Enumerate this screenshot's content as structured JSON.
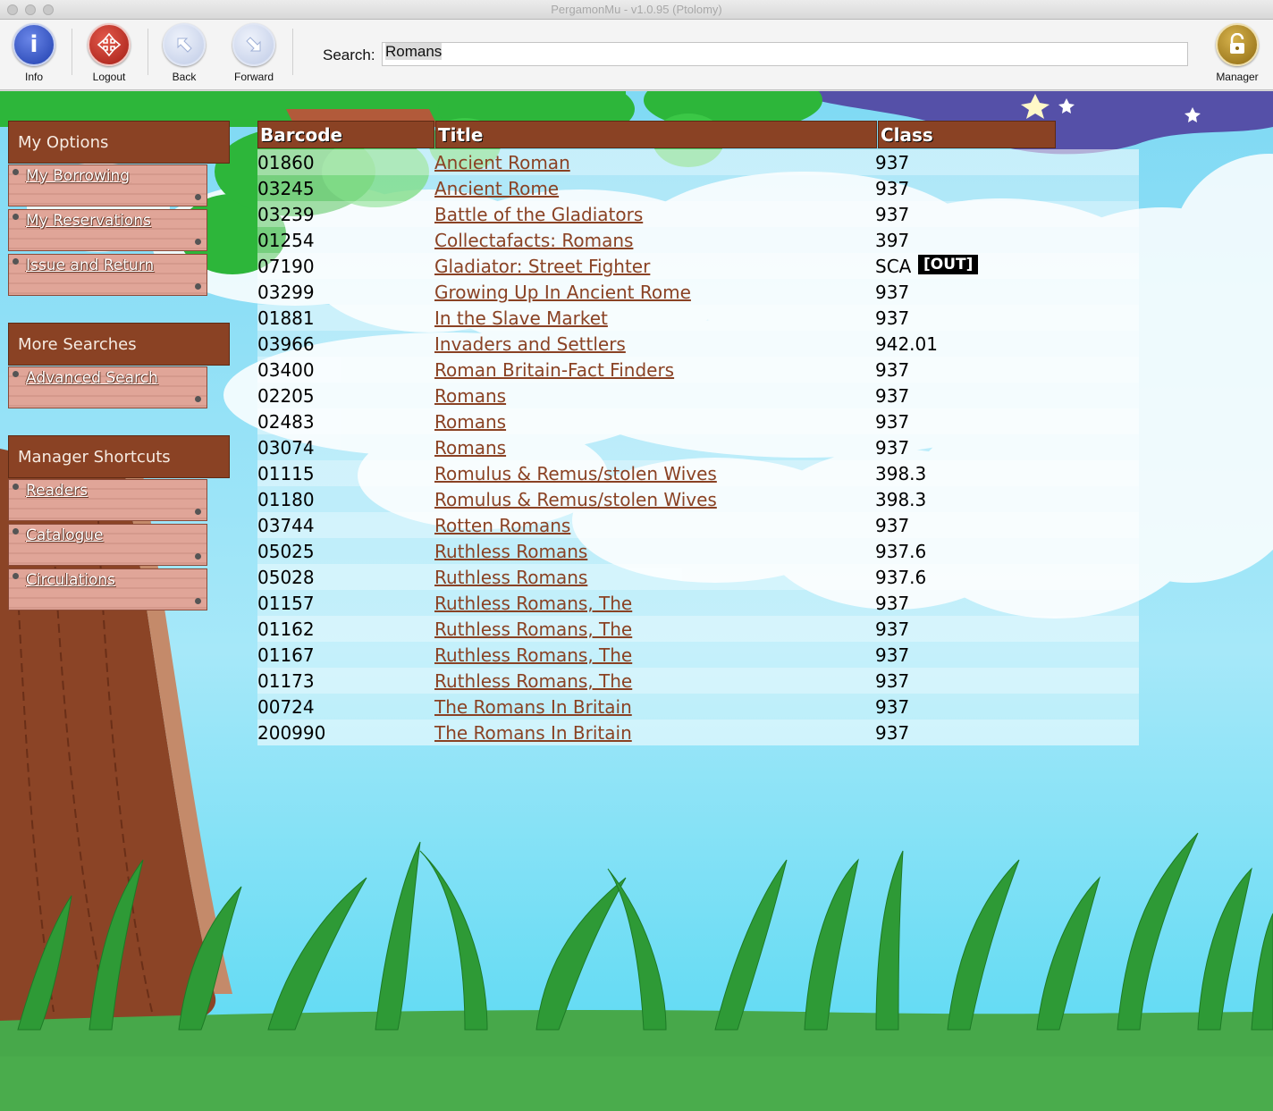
{
  "window": {
    "title": "PergamonMu - v1.0.95 (Ptolomy)"
  },
  "toolbar": {
    "info_label": "Info",
    "logout_label": "Logout",
    "back_label": "Back",
    "forward_label": "Forward",
    "manager_label": "Manager",
    "search_label": "Search:",
    "search_value": "Romans"
  },
  "icons": {
    "info": "info-icon",
    "logout": "logout-icon",
    "back": "back-arrow-icon",
    "forward": "forward-arrow-icon",
    "manager": "lock-icon"
  },
  "colors": {
    "accent": "#8a4224",
    "plank": "#e0a598",
    "title_link": "#8a4224"
  },
  "sidebar": {
    "sections": [
      {
        "title": "My Options",
        "items": [
          "My Borrowing",
          "My Reservations",
          "Issue and Return"
        ]
      },
      {
        "title": "More Searches",
        "items": [
          "Advanced Search"
        ]
      },
      {
        "title": "Manager Shortcuts",
        "items": [
          "Readers",
          "Catalogue",
          "Circulations"
        ]
      }
    ]
  },
  "table": {
    "headers": {
      "barcode": "Barcode",
      "title": "Title",
      "class": "Class"
    },
    "rows": [
      {
        "barcode": "01860",
        "title": "Ancient Roman",
        "class": "937"
      },
      {
        "barcode": "03245",
        "title": "Ancient Rome",
        "class": "937"
      },
      {
        "barcode": "03239",
        "title": "Battle of the Gladiators",
        "class": "937"
      },
      {
        "barcode": "01254",
        "title": "Collectafacts: Romans",
        "class": "397"
      },
      {
        "barcode": "07190",
        "title": "Gladiator: Street Fighter",
        "class": "SCA",
        "status": "[OUT]"
      },
      {
        "barcode": "03299",
        "title": "Growing Up In Ancient Rome",
        "class": "937"
      },
      {
        "barcode": "01881",
        "title": "In the Slave Market",
        "class": "937"
      },
      {
        "barcode": "03966",
        "title": "Invaders and Settlers",
        "class": "942.01"
      },
      {
        "barcode": "03400",
        "title": "Roman Britain-Fact Finders",
        "class": "937"
      },
      {
        "barcode": "02205",
        "title": "Romans",
        "class": "937"
      },
      {
        "barcode": "02483",
        "title": "Romans",
        "class": "937"
      },
      {
        "barcode": "03074",
        "title": "Romans",
        "class": "937"
      },
      {
        "barcode": "01115",
        "title": "Romulus & Remus/stolen Wives",
        "class": "398.3"
      },
      {
        "barcode": "01180",
        "title": "Romulus & Remus/stolen Wives",
        "class": "398.3"
      },
      {
        "barcode": "03744",
        "title": "Rotten Romans",
        "class": "937"
      },
      {
        "barcode": "05025",
        "title": "Ruthless Romans",
        "class": "937.6"
      },
      {
        "barcode": "05028",
        "title": "Ruthless Romans",
        "class": "937.6"
      },
      {
        "barcode": "01157",
        "title": "Ruthless Romans, The",
        "class": "937"
      },
      {
        "barcode": "01162",
        "title": "Ruthless Romans, The",
        "class": "937"
      },
      {
        "barcode": "01167",
        "title": "Ruthless Romans, The",
        "class": "937"
      },
      {
        "barcode": "01173",
        "title": "Ruthless Romans, The",
        "class": "937"
      },
      {
        "barcode": "00724",
        "title": "The Romans In Britain",
        "class": "937"
      },
      {
        "barcode": "200990",
        "title": "The Romans In Britain",
        "class": "937"
      }
    ]
  }
}
